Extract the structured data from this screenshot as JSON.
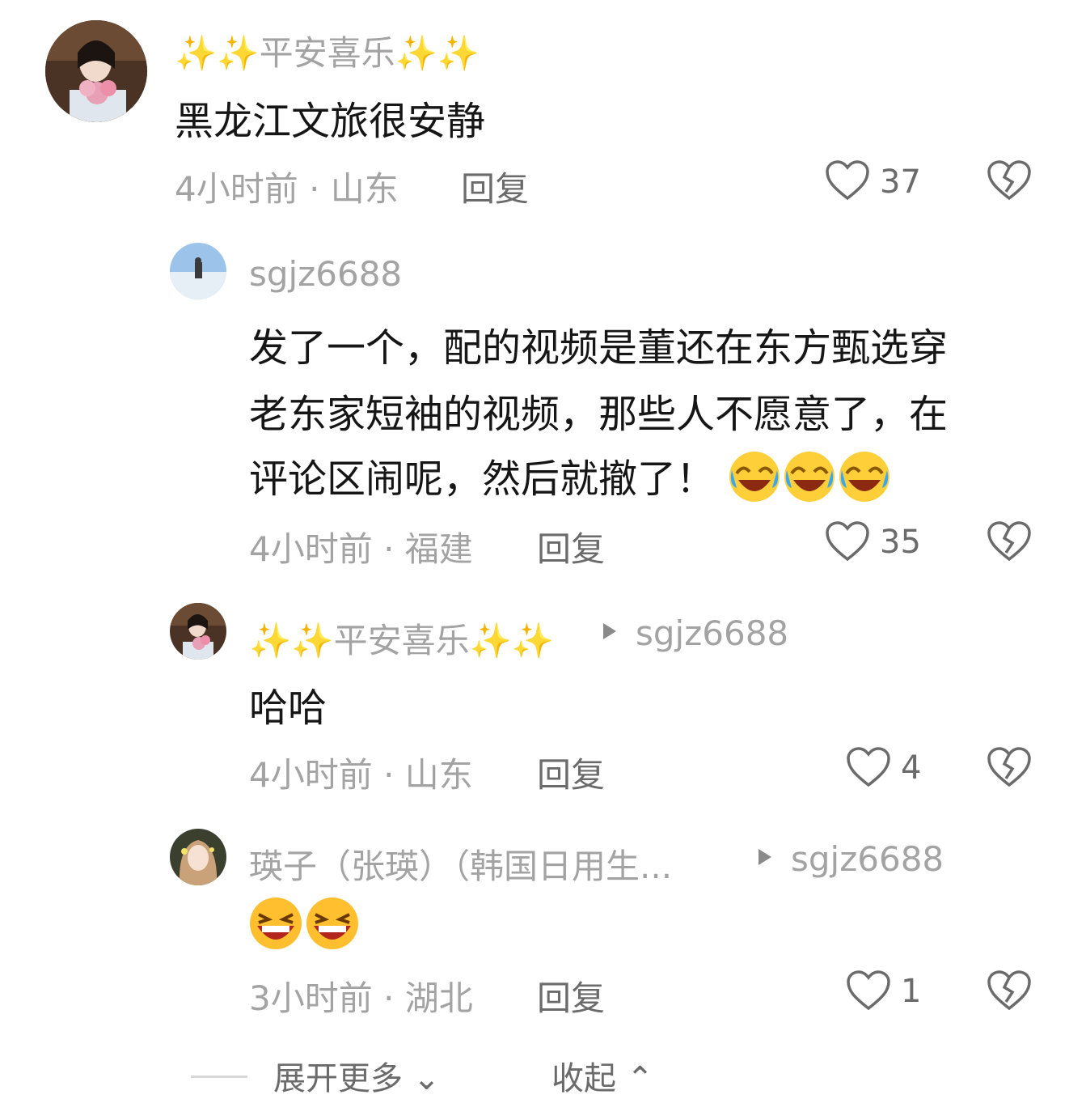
{
  "comments": [
    {
      "username": "✨✨平安喜乐✨✨",
      "name_plain": "平安喜乐",
      "text": "黑龙江文旅很安静",
      "time": "4小时前",
      "location": "山东",
      "reply_label": "回复",
      "likes": "37"
    },
    {
      "username": "sgjz6688",
      "text_lines": [
        "发了一个，配的视频是董还在东方甄选穿",
        "老东家短袖的视频，那些人不愿意了，在",
        "评论区闹呢，然后就撤了！"
      ],
      "emojis": [
        "laugh-cry-emoji",
        "laugh-cry-emoji",
        "laugh-cry-emoji"
      ],
      "time": "4小时前",
      "location": "福建",
      "reply_label": "回复",
      "likes": "35"
    },
    {
      "username": "✨✨平安喜乐✨✨",
      "name_plain": "平安喜乐",
      "reply_to": "sgjz6688",
      "text": "哈哈",
      "time": "4小时前",
      "location": "山东",
      "reply_label": "回复",
      "likes": "4"
    },
    {
      "username": "瑛子（张瑛）（韩国日用生...",
      "reply_to": "sgjz6688",
      "emojis": [
        "grin-emoji",
        "grin-emoji"
      ],
      "time": "3小时前",
      "location": "湖北",
      "reply_label": "回复",
      "likes": "1"
    }
  ],
  "footer": {
    "expand_label": "展开更多",
    "collapse_label": "收起"
  },
  "colors": {
    "meta_gray": "#a3a3a3",
    "text_dark": "#161616",
    "icon_gray": "#6b6b6b",
    "sparkle": "#f3d46b"
  }
}
